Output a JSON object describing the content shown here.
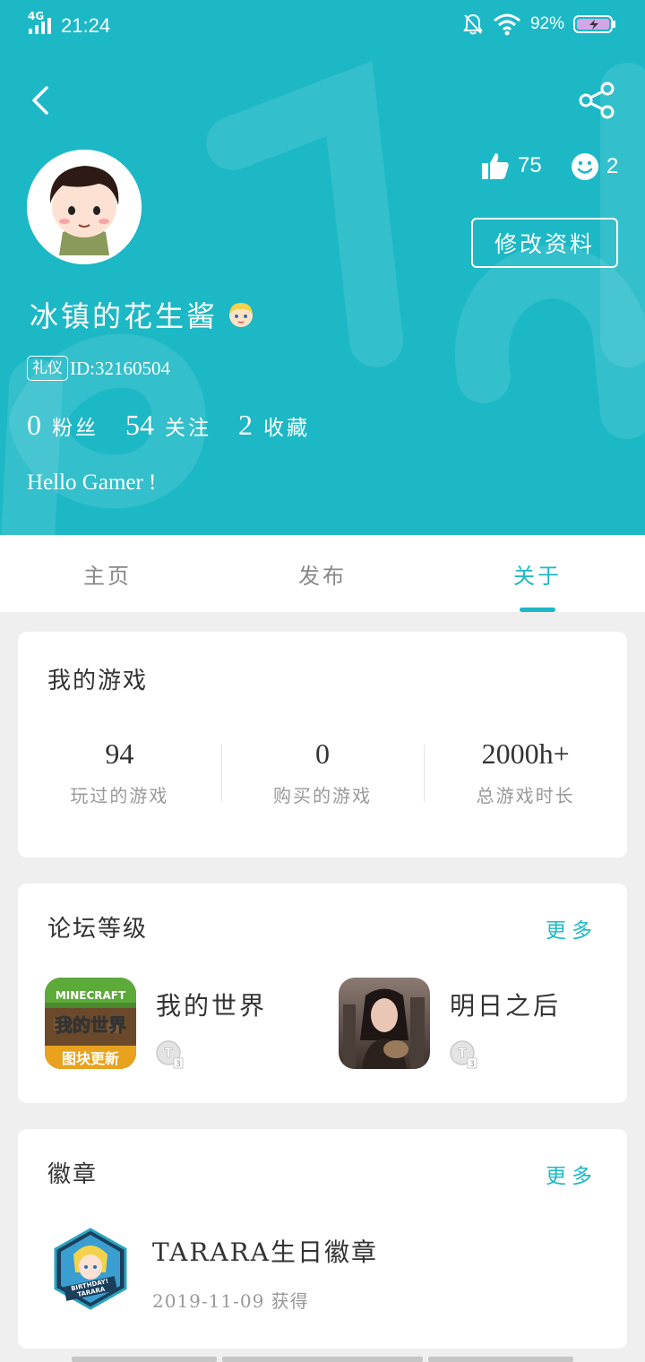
{
  "status_bar": {
    "network": "4G",
    "time": "21:24",
    "battery": "92%"
  },
  "profile": {
    "likes": "75",
    "smiles": "2",
    "edit_label": "修改资料",
    "username": "冰镇的花生酱",
    "tag": "礼仪",
    "id": "ID:32160504",
    "fans_count": "0",
    "fans_label": "粉丝",
    "follow_count": "54",
    "follow_label": "关注",
    "fav_count": "2",
    "fav_label": "收藏",
    "bio": "Hello Gamer !"
  },
  "tabs": [
    {
      "label": "主页"
    },
    {
      "label": "发布"
    },
    {
      "label": "关于"
    }
  ],
  "my_games": {
    "title": "我的游戏",
    "stats": [
      {
        "value": "94",
        "label": "玩过的游戏"
      },
      {
        "value": "0",
        "label": "购买的游戏"
      },
      {
        "value": "2000h+",
        "label": "总游戏时长"
      }
    ]
  },
  "forum": {
    "title": "论坛等级",
    "more": "更多",
    "items": [
      {
        "name": "我的世界",
        "icon_text": "我的世界",
        "icon_top": "MINECRAFT",
        "icon_bottom": "图块更新",
        "level": "T3"
      },
      {
        "name": "明日之后",
        "level": "T3"
      }
    ]
  },
  "badges": {
    "title": "徽章",
    "more": "更多",
    "item": {
      "name": "TARARA生日徽章",
      "date": "2019-11-09 获得",
      "icon_text1": "BIRTHDAY!",
      "icon_text2": "TARARA"
    }
  },
  "colors": {
    "accent": "#1cb8c6",
    "background": "#efefef"
  }
}
